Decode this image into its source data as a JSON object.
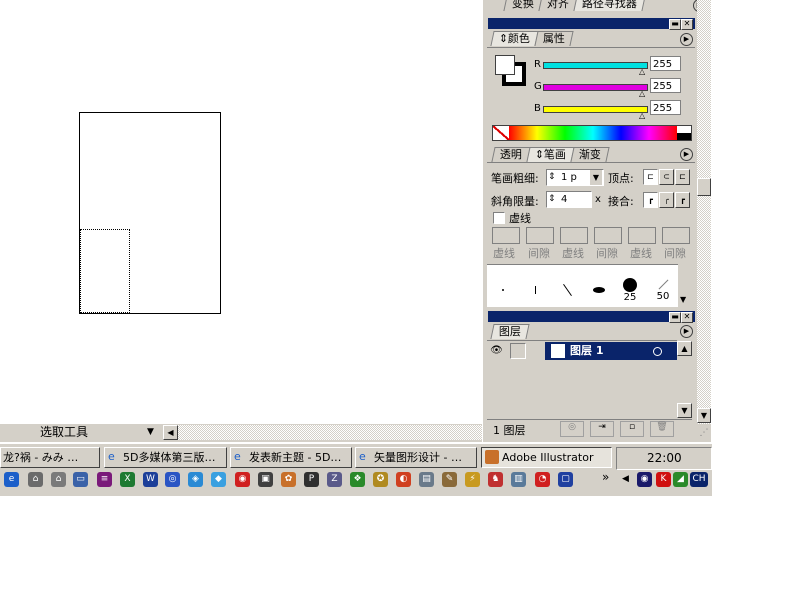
{
  "top_tabs": [
    "变换",
    "对齐",
    "路径寻找器"
  ],
  "color_panel": {
    "tabs": [
      "颜色",
      "属性"
    ],
    "channels": [
      {
        "label": "R",
        "value": "255",
        "color": "#00e0e0"
      },
      {
        "label": "G",
        "value": "255",
        "color": "#e000e0"
      },
      {
        "label": "B",
        "value": "255",
        "color": "#ffff00"
      }
    ]
  },
  "stroke_panel": {
    "tabs": [
      "透明",
      "笔画",
      "渐变"
    ],
    "weight_label": "笔画粗细:",
    "weight_value": "1 p",
    "cap_label": "顶点:",
    "miter_label": "斜角限量:",
    "miter_value": "4",
    "miter_unit": "x",
    "join_label": "接合:",
    "dashed_label": "虚线",
    "dash_labels": [
      "虚线",
      "间隙",
      "虚线",
      "间隙",
      "虚线",
      "间隙"
    ]
  },
  "brushes": {
    "size_labels": [
      "25",
      "50"
    ]
  },
  "layers_panel": {
    "tab": "图层",
    "layers": [
      {
        "name": "图层 1"
      }
    ],
    "footer_count": "1 图层"
  },
  "tool_status": "选取工具",
  "taskbar": {
    "buttons": [
      {
        "label": "龙?祸 - みみ …"
      },
      {
        "label": "5D多媒体第三版…"
      },
      {
        "label": "发表新主题 - 5D…"
      },
      {
        "label": "矢量图形设计 - …"
      },
      {
        "label": "Adobe Illustrator"
      }
    ],
    "clock": "22:00",
    "lang": "CH",
    "more": "»"
  }
}
